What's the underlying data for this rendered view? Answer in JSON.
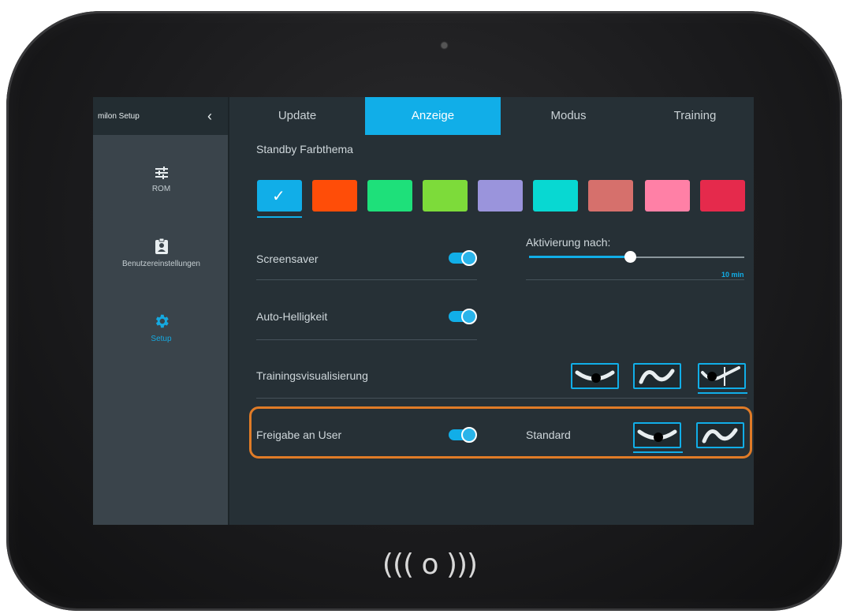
{
  "sidebar": {
    "title": "milon Setup",
    "items": [
      {
        "label": "ROM",
        "icon": "sliders-icon"
      },
      {
        "label": "Benutzereinstellungen",
        "icon": "clipboard-user-icon"
      },
      {
        "label": "Setup",
        "icon": "gear-icon"
      }
    ]
  },
  "tabs": [
    {
      "label": "Update"
    },
    {
      "label": "Anzeige"
    },
    {
      "label": "Modus"
    },
    {
      "label": "Training"
    }
  ],
  "standby": {
    "title": "Standby Farbthema",
    "swatches": [
      "#11aee8",
      "#ff4d08",
      "#1ee07a",
      "#7ddb3a",
      "#9a94dc",
      "#08d8d2",
      "#d6706c",
      "#ff80a6",
      "#e52a4c"
    ],
    "selected_index": 0
  },
  "screensaver": {
    "label": "Screensaver",
    "enabled": true,
    "activation_label": "Aktivierung nach:",
    "activation_value": "10 min"
  },
  "auto_brightness": {
    "label": "Auto-Helligkeit",
    "enabled": true
  },
  "training_visualization": {
    "label": "Trainingsvisualisierung",
    "options": [
      "curve-dot-icon",
      "wave-icon",
      "curve-dot-line-icon"
    ],
    "selected_index": 2
  },
  "release": {
    "label": "Freigabe an User",
    "enabled": true,
    "standard_label": "Standard",
    "options": [
      "curve-dot-icon",
      "wave-icon"
    ],
    "selected_index": 0
  },
  "colors": {
    "accent": "#11aee8",
    "highlight": "#e07b27"
  }
}
